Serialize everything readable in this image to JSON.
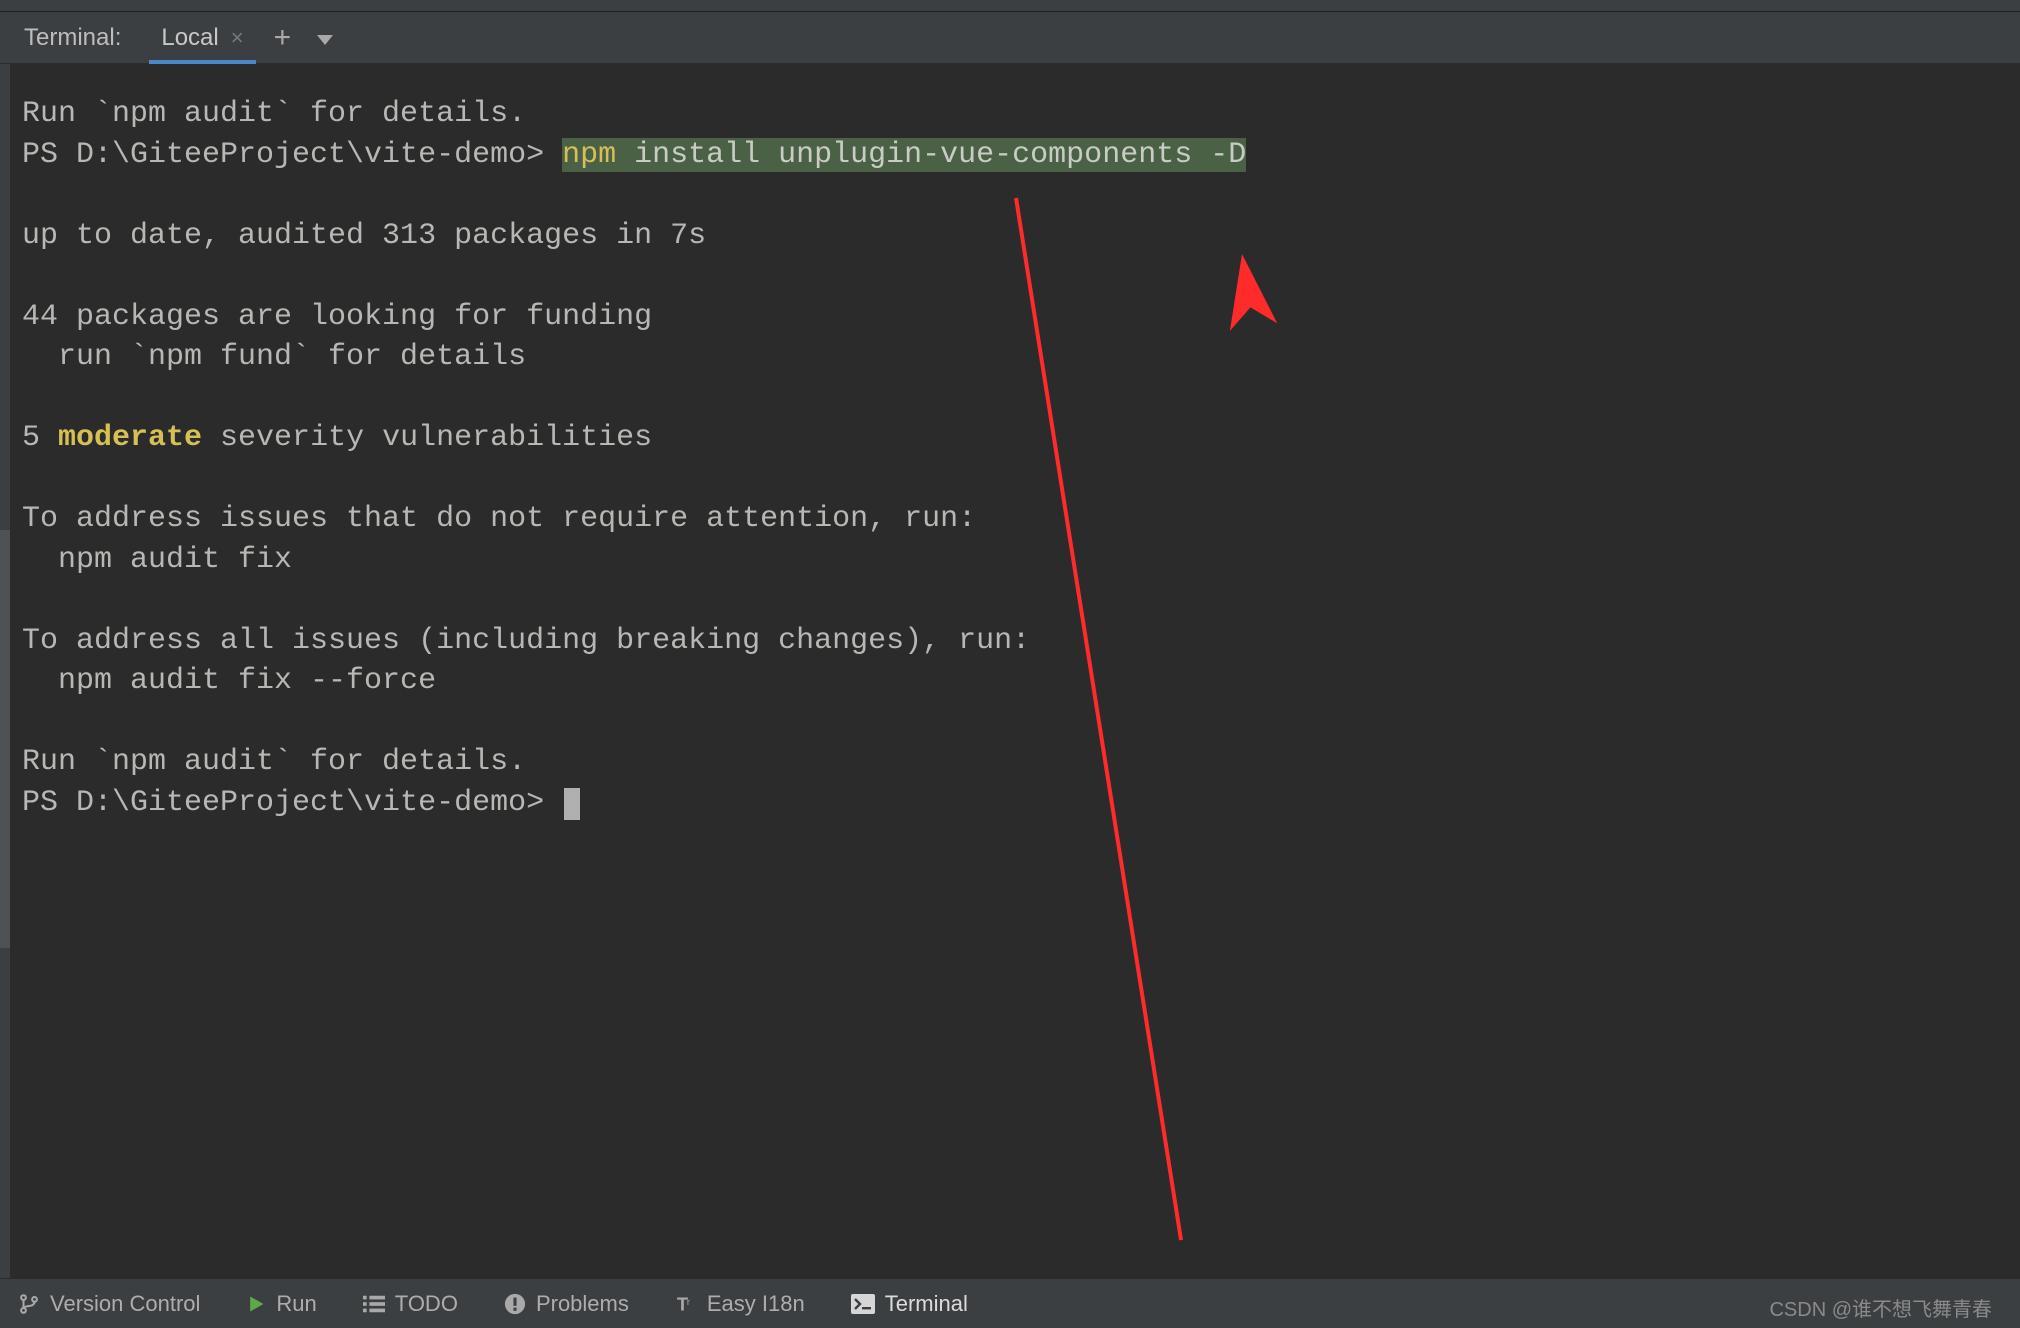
{
  "header": {
    "title": "Terminal:",
    "tab_label": "Local"
  },
  "terminal": {
    "line1": "Run `npm audit` for details.",
    "prompt1_prefix": "PS D:\\GiteeProject\\vite-demo> ",
    "cmd_npm": "npm",
    "cmd_rest": " install unplugin-vue-components ",
    "cmd_flag": "-D",
    "line_blank": "",
    "line3": "up to date, audited 313 packages in 7s",
    "line5": "44 packages are looking for funding",
    "line6": "  run `npm fund` for details",
    "line8_prefix": "5 ",
    "line8_kw": "moderate",
    "line8_suffix": " severity vulnerabilities",
    "line10": "To address issues that do not require attention, run:",
    "line11": "  npm audit fix",
    "line13": "To address all issues (including breaking changes), run:",
    "line14": "  npm audit fix --force",
    "line16": "Run `npm audit` for details.",
    "prompt2": "PS D:\\GiteeProject\\vite-demo> "
  },
  "bottom": {
    "version_control": "Version Control",
    "run": "Run",
    "todo": "TODO",
    "problems": "Problems",
    "easy_i18n": "Easy I18n",
    "terminal": "Terminal"
  },
  "watermark": "CSDN @谁不想飞舞青春"
}
